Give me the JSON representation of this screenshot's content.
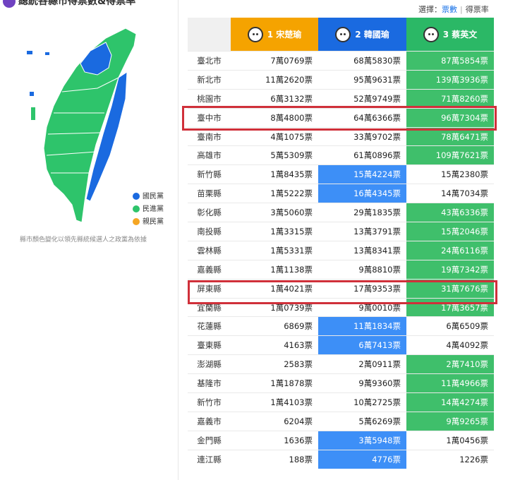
{
  "title": "總統各縣市得票數&得票率",
  "selector": {
    "label": "選擇：",
    "option_votes": "票數",
    "option_rate": "得票率"
  },
  "legend": [
    {
      "label": "國民黨",
      "color": "#1a6ae0"
    },
    {
      "label": "民進黨",
      "color": "#2ec46b"
    },
    {
      "label": "親民黨",
      "color": "#f5a623"
    }
  ],
  "map_note": "縣市顏色變化以領先縣統候選人之政黨為依據",
  "candidates": [
    {
      "label": "1 宋楚瑜",
      "color": "#f5a300"
    },
    {
      "label": "2 韓國瑜",
      "color": "#1a6ae0"
    },
    {
      "label": "3 蔡英文",
      "color": "#2bb866"
    }
  ],
  "rows": [
    {
      "county": "臺北市",
      "v1": "7萬0769票",
      "v2": "68萬5830票",
      "v3": "87萬5854票",
      "lead": 3
    },
    {
      "county": "新北市",
      "v1": "11萬2620票",
      "v2": "95萬9631票",
      "v3": "139萬3936票",
      "lead": 3
    },
    {
      "county": "桃園市",
      "v1": "6萬3132票",
      "v2": "52萬9749票",
      "v3": "71萬8260票",
      "lead": 3
    },
    {
      "county": "臺中市",
      "v1": "8萬4800票",
      "v2": "64萬6366票",
      "v3": "96萬7304票",
      "lead": 3
    },
    {
      "county": "臺南市",
      "v1": "4萬1075票",
      "v2": "33萬9702票",
      "v3": "78萬6471票",
      "lead": 3
    },
    {
      "county": "高雄市",
      "v1": "5萬5309票",
      "v2": "61萬0896票",
      "v3": "109萬7621票",
      "lead": 3
    },
    {
      "county": "新竹縣",
      "v1": "1萬8435票",
      "v2": "15萬4224票",
      "v3": "15萬2380票",
      "lead": 2
    },
    {
      "county": "苗栗縣",
      "v1": "1萬5222票",
      "v2": "16萬4345票",
      "v3": "14萬7034票",
      "lead": 2
    },
    {
      "county": "彰化縣",
      "v1": "3萬5060票",
      "v2": "29萬1835票",
      "v3": "43萬6336票",
      "lead": 3
    },
    {
      "county": "南投縣",
      "v1": "1萬3315票",
      "v2": "13萬3791票",
      "v3": "15萬2046票",
      "lead": 3
    },
    {
      "county": "雲林縣",
      "v1": "1萬5331票",
      "v2": "13萬8341票",
      "v3": "24萬6116票",
      "lead": 3
    },
    {
      "county": "嘉義縣",
      "v1": "1萬1138票",
      "v2": "9萬8810票",
      "v3": "19萬7342票",
      "lead": 3
    },
    {
      "county": "屏東縣",
      "v1": "1萬4021票",
      "v2": "17萬9353票",
      "v3": "31萬7676票",
      "lead": 3
    },
    {
      "county": "宜蘭縣",
      "v1": "1萬0739票",
      "v2": "9萬0010票",
      "v3": "17萬3657票",
      "lead": 3
    },
    {
      "county": "花蓮縣",
      "v1": "6869票",
      "v2": "11萬1834票",
      "v3": "6萬6509票",
      "lead": 2
    },
    {
      "county": "臺東縣",
      "v1": "4163票",
      "v2": "6萬7413票",
      "v3": "4萬4092票",
      "lead": 2
    },
    {
      "county": "澎湖縣",
      "v1": "2583票",
      "v2": "2萬0911票",
      "v3": "2萬7410票",
      "lead": 3
    },
    {
      "county": "基隆市",
      "v1": "1萬1878票",
      "v2": "9萬9360票",
      "v3": "11萬4966票",
      "lead": 3
    },
    {
      "county": "新竹市",
      "v1": "1萬4103票",
      "v2": "10萬2725票",
      "v3": "14萬4274票",
      "lead": 3
    },
    {
      "county": "嘉義市",
      "v1": "6204票",
      "v2": "5萬6269票",
      "v3": "9萬9265票",
      "lead": 3
    },
    {
      "county": "金門縣",
      "v1": "1636票",
      "v2": "3萬5948票",
      "v3": "1萬0456票",
      "lead": 2
    },
    {
      "county": "連江縣",
      "v1": "188票",
      "v2": "4776票",
      "v3": "1226票",
      "lead": 2
    }
  ],
  "highlighted_counties": [
    "臺中市",
    "屏東縣"
  ]
}
